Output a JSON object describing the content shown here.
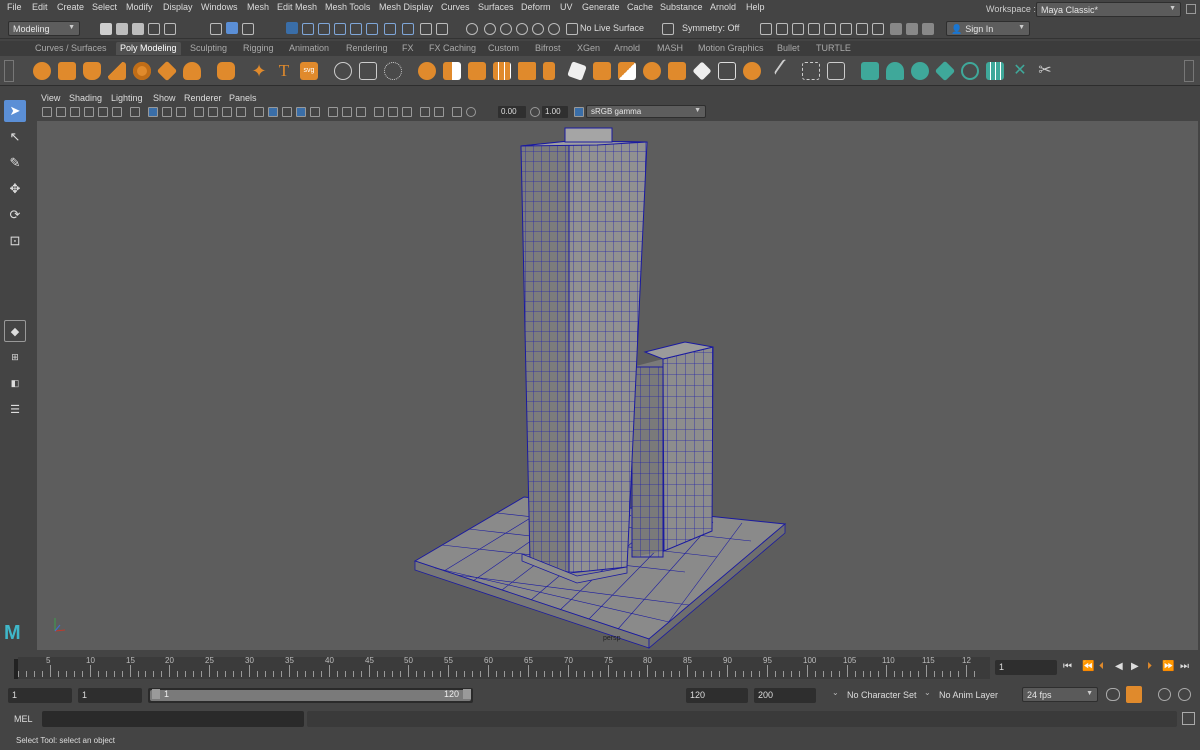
{
  "menubar": {
    "items": [
      "File",
      "Edit",
      "Create",
      "Select",
      "Modify",
      "Display",
      "Windows",
      "Mesh",
      "Edit Mesh",
      "Mesh Tools",
      "Mesh Display",
      "Curves",
      "Surfaces",
      "Deform",
      "UV",
      "Generate",
      "Cache",
      "Substance",
      "Arnold",
      "Help"
    ],
    "workspace_label": "Workspace :",
    "workspace_value": "Maya Classic*"
  },
  "statusline": {
    "mode": "Modeling",
    "live_surface": "No Live Surface",
    "symmetry": "Symmetry: Off",
    "sign_in": "Sign In"
  },
  "shelf": {
    "tabs": [
      "Curves / Surfaces",
      "Poly Modeling",
      "Sculpting",
      "Rigging",
      "Animation",
      "Rendering",
      "FX",
      "FX Caching",
      "Custom",
      "Bifrost",
      "XGen",
      "Arnold",
      "MASH",
      "Motion Graphics",
      "Bullet",
      "TURTLE"
    ],
    "active_tab": "Poly Modeling",
    "svg_label": "svg",
    "text_label": "T"
  },
  "panel": {
    "menus": [
      "View",
      "Shading",
      "Lighting",
      "Show",
      "Renderer",
      "Panels"
    ],
    "exposure": "0.00",
    "gamma": "1.00",
    "color_space": "sRGB gamma"
  },
  "viewport": {
    "camera_label": "persp"
  },
  "timeline": {
    "ticks": [
      "5",
      "10",
      "15",
      "20",
      "25",
      "30",
      "35",
      "40",
      "45",
      "50",
      "55",
      "60",
      "65",
      "70",
      "75",
      "80",
      "85",
      "90",
      "95",
      "100",
      "105",
      "110",
      "115",
      "12"
    ],
    "current_frame": "1"
  },
  "range": {
    "start": "1",
    "playback_start": "1",
    "slider_start": "1",
    "slider_end": "120",
    "playback_end": "120",
    "end": "200",
    "character_set": "No Character Set",
    "anim_layer": "No Anim Layer",
    "fps": "24 fps"
  },
  "command": {
    "language": "MEL"
  },
  "helpline": {
    "text": "Select Tool: select an object"
  },
  "colors": {
    "accent_blue": "#5b8fd6",
    "shelf_orange": "#e08a2c",
    "shelf_teal": "#3fa89a",
    "wireframe": "#1a1aa0",
    "viewport_bg": "#5d5d5d"
  }
}
